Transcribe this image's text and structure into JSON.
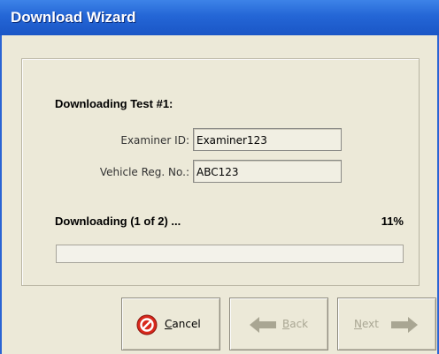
{
  "window": {
    "title": "Download Wizard"
  },
  "download": {
    "heading": "Downloading Test #1:",
    "examiner_label": "Examiner ID:",
    "examiner_value": "Examiner123",
    "vehicle_label": "Vehicle Reg. No.:",
    "vehicle_value": "ABC123",
    "status_text": "Downloading (1 of 2) ...",
    "percent_text": "11%",
    "progress_fraction": 0.0
  },
  "buttons": {
    "cancel_accel": "C",
    "cancel_rest": "ancel",
    "back_accel": "B",
    "back_rest": "ack",
    "next_accel": "N",
    "next_rest": "ext"
  },
  "icons": {
    "cancel": "stop-icon",
    "back": "arrow-left-icon",
    "next": "arrow-right-icon"
  },
  "colors": {
    "titlebar": "#2466d6",
    "stop_icon": "#d8281c",
    "disabled_text": "#a9a693"
  }
}
